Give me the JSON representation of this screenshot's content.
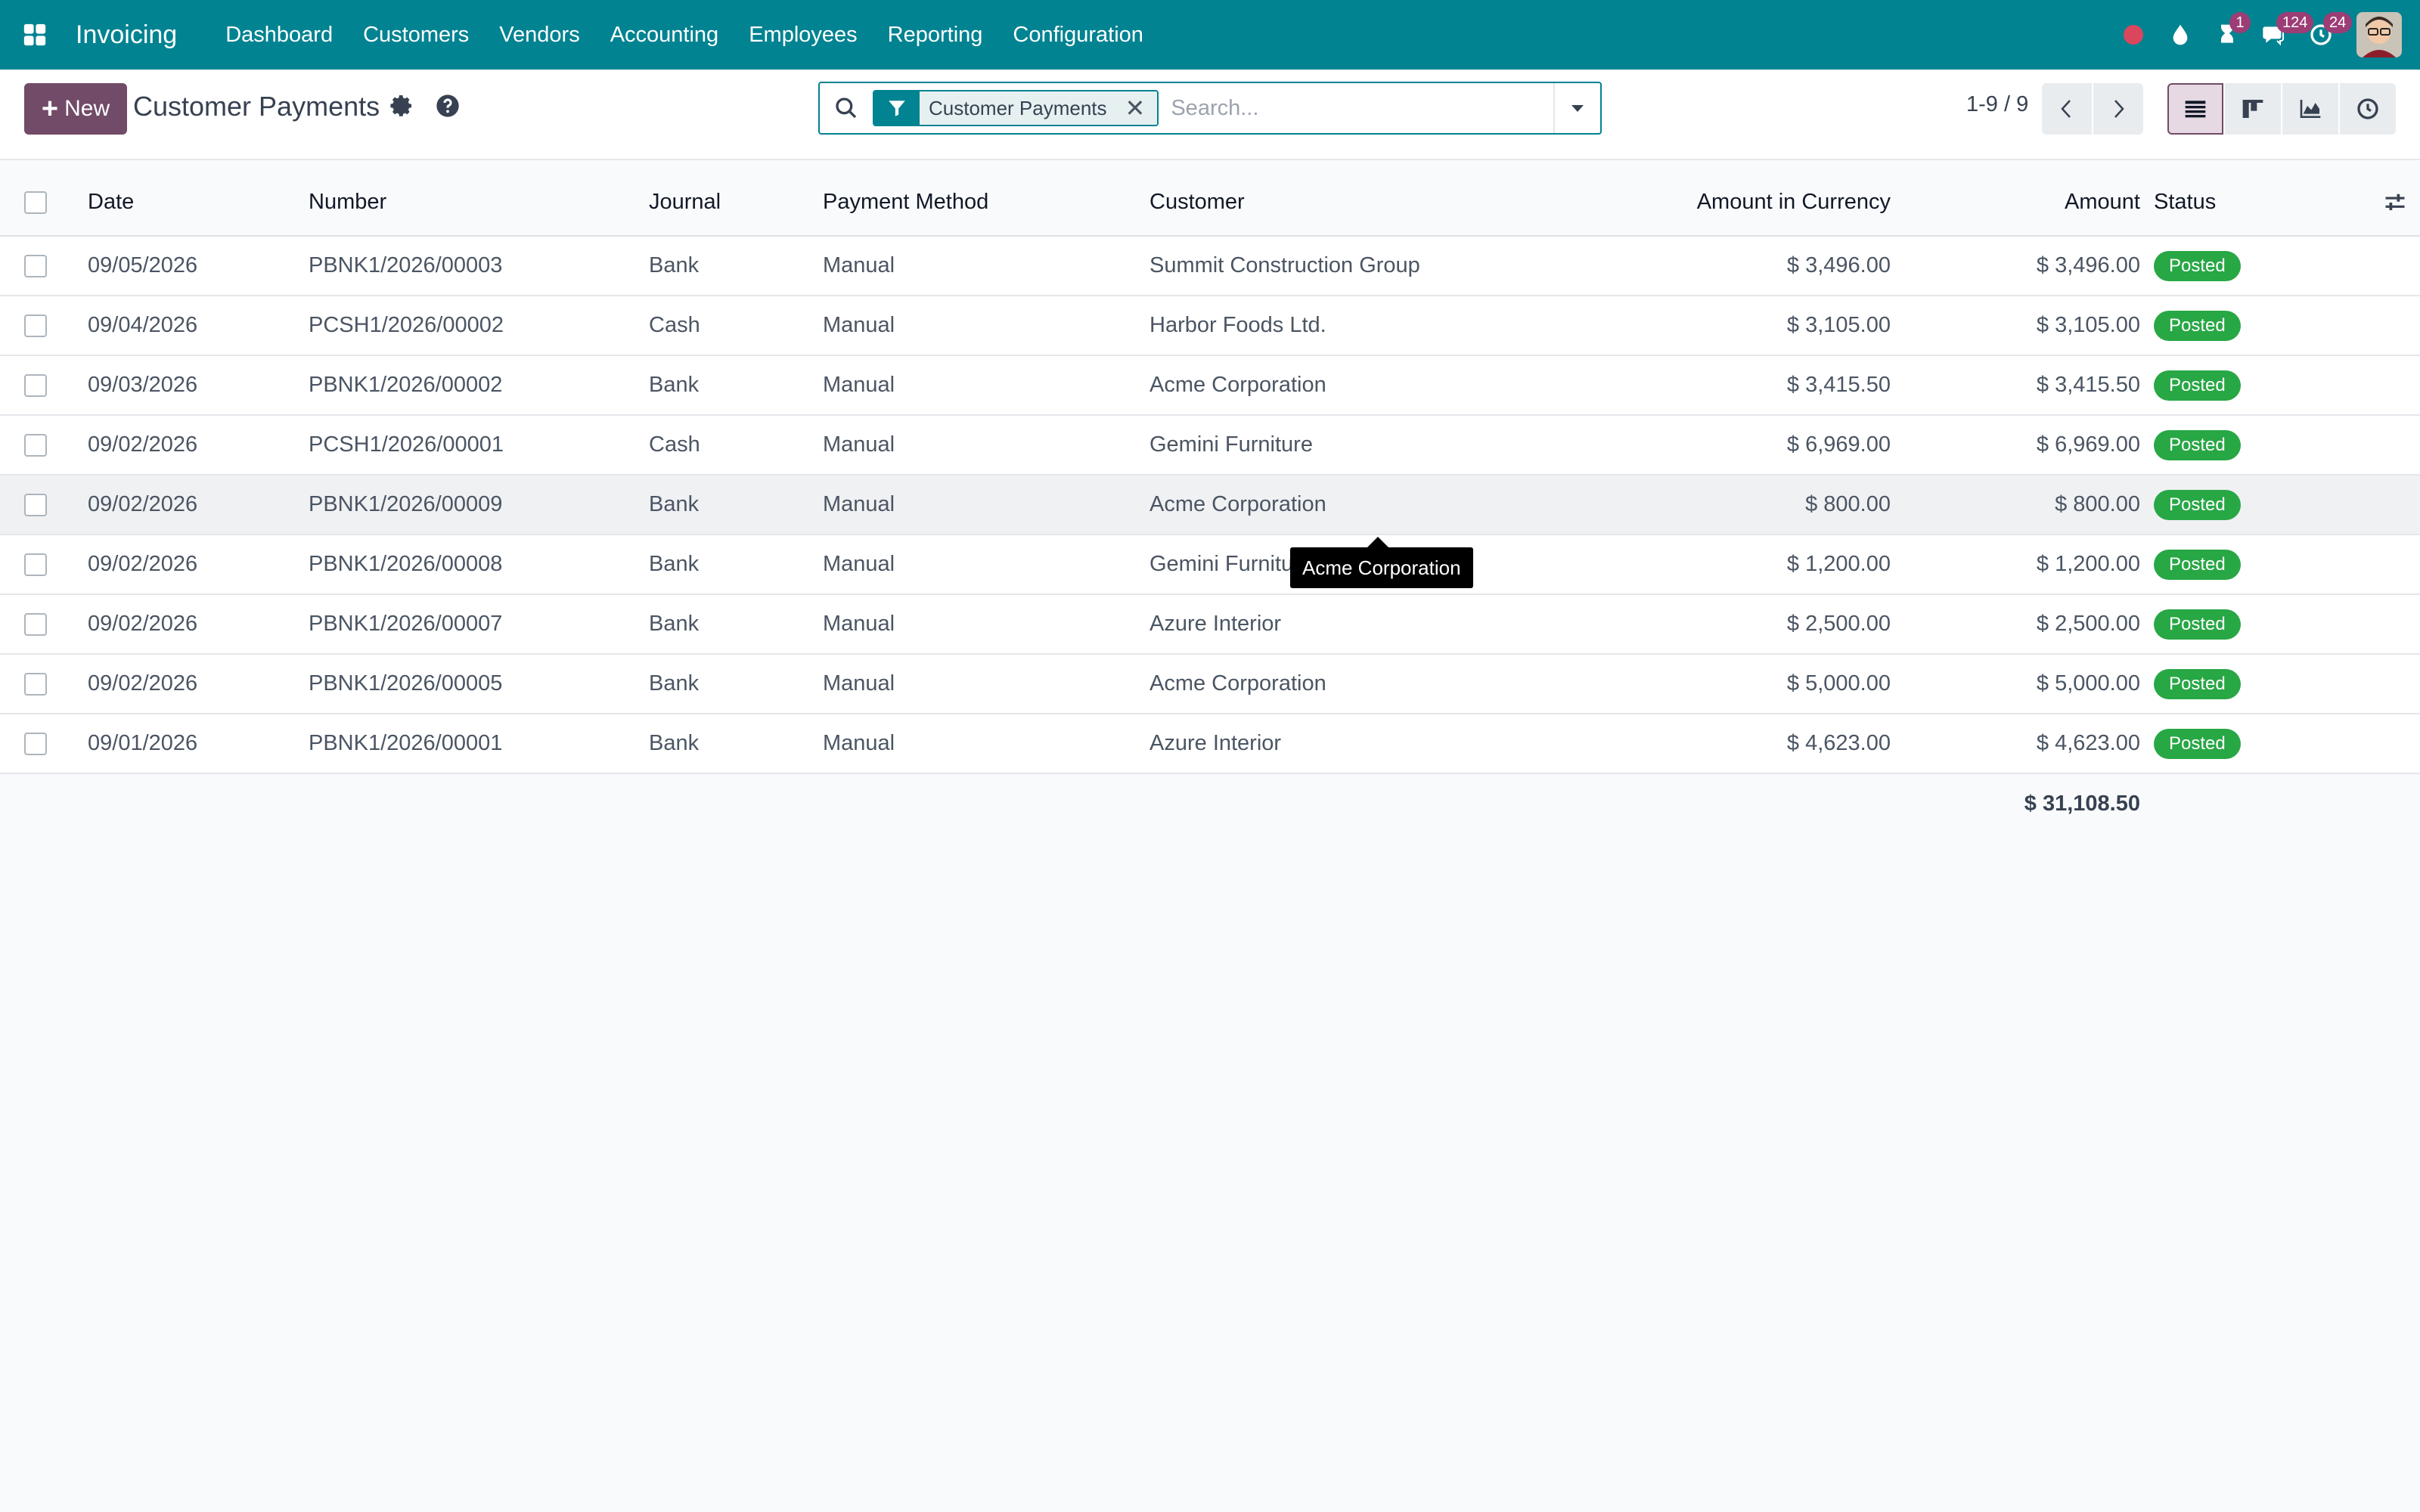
{
  "navbar": {
    "app_name": "Invoicing",
    "menu": [
      "Dashboard",
      "Customers",
      "Vendors",
      "Accounting",
      "Employees",
      "Reporting",
      "Configuration"
    ],
    "badges": {
      "activities": "1",
      "messages": "124",
      "clock": "24"
    },
    "colors": {
      "navbar_bg": "#018391",
      "badge_bg": "#9c3d76",
      "record_dot": "#d9465e"
    }
  },
  "control_panel": {
    "new_label": "New",
    "title": "Customer Payments",
    "search": {
      "facet": "Customer Payments",
      "facet_remove": "✕",
      "placeholder": "Search..."
    },
    "pager": "1-9 / 9",
    "colors": {
      "primary": "#714b67"
    }
  },
  "table": {
    "headers": {
      "date": "Date",
      "number": "Number",
      "journal": "Journal",
      "method": "Payment Method",
      "customer": "Customer",
      "amount_currency": "Amount in Currency",
      "amount": "Amount",
      "status": "Status"
    },
    "rows": [
      {
        "date": "09/05/2026",
        "number": "PBNK1/2026/00003",
        "journal": "Bank",
        "method": "Manual",
        "customer": "Summit Construction Group",
        "amount_currency": "$ 3,496.00",
        "amount": "$ 3,496.00",
        "status": "Posted"
      },
      {
        "date": "09/04/2026",
        "number": "PCSH1/2026/00002",
        "journal": "Cash",
        "method": "Manual",
        "customer": "Harbor Foods Ltd.",
        "amount_currency": "$ 3,105.00",
        "amount": "$ 3,105.00",
        "status": "Posted"
      },
      {
        "date": "09/03/2026",
        "number": "PBNK1/2026/00002",
        "journal": "Bank",
        "method": "Manual",
        "customer": "Acme Corporation",
        "amount_currency": "$ 3,415.50",
        "amount": "$ 3,415.50",
        "status": "Posted"
      },
      {
        "date": "09/02/2026",
        "number": "PCSH1/2026/00001",
        "journal": "Cash",
        "method": "Manual",
        "customer": "Gemini Furniture",
        "amount_currency": "$ 6,969.00",
        "amount": "$ 6,969.00",
        "status": "Posted"
      },
      {
        "date": "09/02/2026",
        "number": "PBNK1/2026/00009",
        "journal": "Bank",
        "method": "Manual",
        "customer": "Acme Corporation",
        "amount_currency": "$ 800.00",
        "amount": "$ 800.00",
        "status": "Posted"
      },
      {
        "date": "09/02/2026",
        "number": "PBNK1/2026/00008",
        "journal": "Bank",
        "method": "Manual",
        "customer": "Gemini Furniture",
        "amount_currency": "$ 1,200.00",
        "amount": "$ 1,200.00",
        "status": "Posted"
      },
      {
        "date": "09/02/2026",
        "number": "PBNK1/2026/00007",
        "journal": "Bank",
        "method": "Manual",
        "customer": "Azure Interior",
        "amount_currency": "$ 2,500.00",
        "amount": "$ 2,500.00",
        "status": "Posted"
      },
      {
        "date": "09/02/2026",
        "number": "PBNK1/2026/00005",
        "journal": "Bank",
        "method": "Manual",
        "customer": "Acme Corporation",
        "amount_currency": "$ 5,000.00",
        "amount": "$ 5,000.00",
        "status": "Posted"
      },
      {
        "date": "09/01/2026",
        "number": "PBNK1/2026/00001",
        "journal": "Bank",
        "method": "Manual",
        "customer": "Azure Interior",
        "amount_currency": "$ 4,623.00",
        "amount": "$ 4,623.00",
        "status": "Posted"
      }
    ],
    "total_amount": "$ 31,108.50",
    "colors": {
      "posted": "#28a745"
    }
  },
  "tooltip": {
    "text": "Acme Corporation"
  }
}
